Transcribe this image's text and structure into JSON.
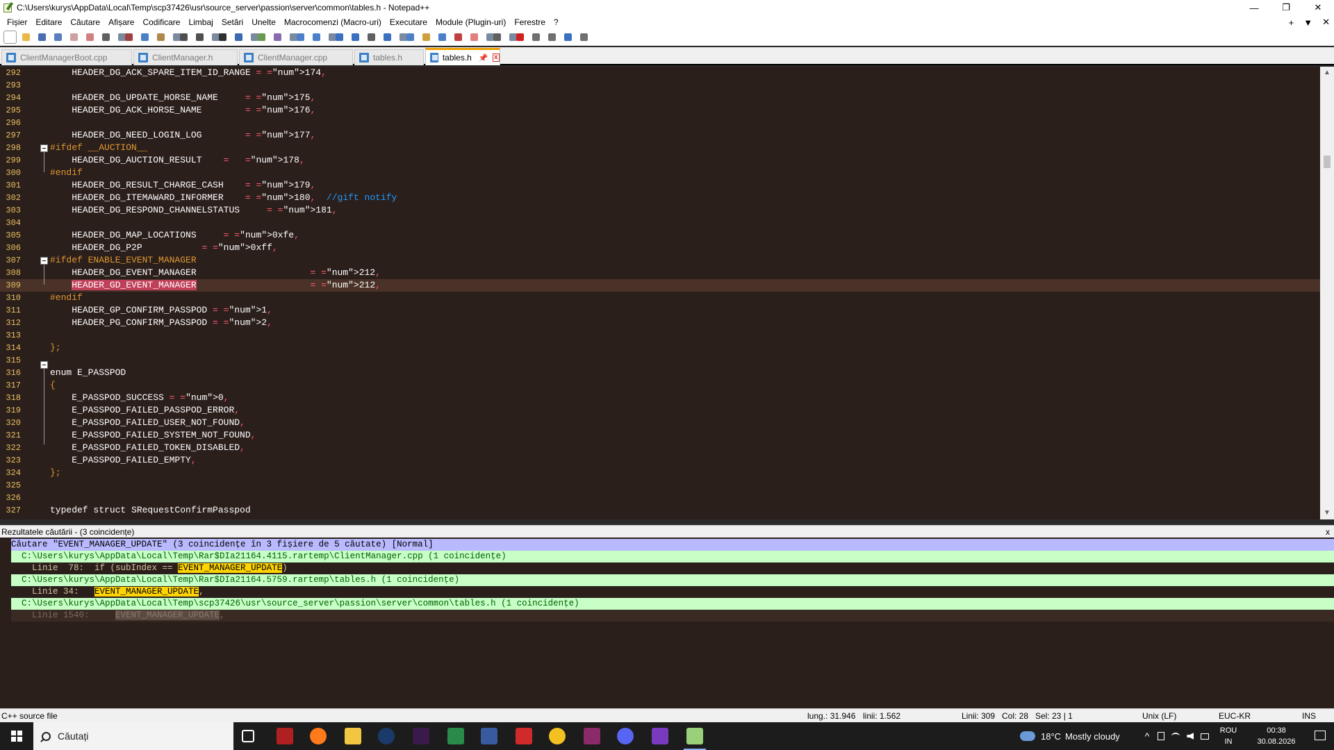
{
  "window": {
    "title": "C:\\Users\\kurys\\AppData\\Local\\Temp\\scp37426\\usr\\source_server\\passion\\server\\common\\tables.h - Notepad++",
    "minimize": "—",
    "maximize": "❐",
    "close": "✕"
  },
  "menu": {
    "items": [
      "Fișier",
      "Editare",
      "Căutare",
      "Afișare",
      "Codificare",
      "Limbaj",
      "Setări",
      "Unelte",
      "Macrocomenzi (Macro-uri)",
      "Executare",
      "Module (Plugin-uri)",
      "Ferestre",
      "?"
    ],
    "right_plus": "+",
    "right_down": "▼",
    "right_close": "✕"
  },
  "tabs": [
    {
      "label": "ClientManagerBoot.cpp",
      "active": false
    },
    {
      "label": "ClientManager.h",
      "active": false
    },
    {
      "label": "ClientManager.cpp",
      "active": false
    },
    {
      "label": "tables.h",
      "active": false
    },
    {
      "label": "tables.h",
      "active": true
    }
  ],
  "tab_pin": "📌",
  "tab_close": "x",
  "editor": {
    "current_line": 309,
    "lines": [
      {
        "n": "292",
        "t": "    HEADER_DG_ACK_SPARE_ITEM_ID_RANGE = 174,"
      },
      {
        "n": "293",
        "t": ""
      },
      {
        "n": "294",
        "t": "    HEADER_DG_UPDATE_HORSE_NAME     = 175,"
      },
      {
        "n": "295",
        "t": "    HEADER_DG_ACK_HORSE_NAME        = 176,"
      },
      {
        "n": "296",
        "t": ""
      },
      {
        "n": "297",
        "t": "    HEADER_DG_NEED_LOGIN_LOG        = 177,"
      },
      {
        "n": "298",
        "t": "#ifdef __AUCTION__"
      },
      {
        "n": "299",
        "t": "    HEADER_DG_AUCTION_RESULT    =   178,"
      },
      {
        "n": "300",
        "t": "#endif"
      },
      {
        "n": "301",
        "t": "    HEADER_DG_RESULT_CHARGE_CASH    = 179,"
      },
      {
        "n": "302",
        "t": "    HEADER_DG_ITEMAWARD_INFORMER    = 180,  //gift notify"
      },
      {
        "n": "303",
        "t": "    HEADER_DG_RESPOND_CHANNELSTATUS     = 181,"
      },
      {
        "n": "304",
        "t": ""
      },
      {
        "n": "305",
        "t": "    HEADER_DG_MAP_LOCATIONS     = 0xfe,"
      },
      {
        "n": "306",
        "t": "    HEADER_DG_P2P           = 0xff,"
      },
      {
        "n": "307",
        "t": "#ifdef ENABLE_EVENT_MANAGER"
      },
      {
        "n": "308",
        "t": "    HEADER_DG_EVENT_MANAGER                     = 212,"
      },
      {
        "n": "309",
        "t": "    HEADER_GD_EVENT_MANAGER                     = 212,"
      },
      {
        "n": "310",
        "t": "#endif"
      },
      {
        "n": "311",
        "t": "    HEADER_GP_CONFIRM_PASSPOD = 1,"
      },
      {
        "n": "312",
        "t": "    HEADER_PG_CONFIRM_PASSPOD = 2,"
      },
      {
        "n": "313",
        "t": ""
      },
      {
        "n": "314",
        "t": "};"
      },
      {
        "n": "315",
        "t": ""
      },
      {
        "n": "316",
        "t": "enum E_PASSPOD"
      },
      {
        "n": "317",
        "t": "{"
      },
      {
        "n": "318",
        "t": "    E_PASSPOD_SUCCESS = 0,"
      },
      {
        "n": "319",
        "t": "    E_PASSPOD_FAILED_PASSPOD_ERROR,"
      },
      {
        "n": "320",
        "t": "    E_PASSPOD_FAILED_USER_NOT_FOUND,"
      },
      {
        "n": "321",
        "t": "    E_PASSPOD_FAILED_SYSTEM_NOT_FOUND,"
      },
      {
        "n": "322",
        "t": "    E_PASSPOD_FAILED_TOKEN_DISABLED,"
      },
      {
        "n": "323",
        "t": "    E_PASSPOD_FAILED_EMPTY,"
      },
      {
        "n": "324",
        "t": "};"
      },
      {
        "n": "325",
        "t": ""
      },
      {
        "n": "326",
        "t": ""
      },
      {
        "n": "327",
        "t": "typedef struct SRequestConfirmPasspod"
      }
    ]
  },
  "results": {
    "title": "Rezultatele căutării - (3 coincidențe)",
    "close": "x",
    "search_line": "Căutare \"EVENT_MANAGER_UPDATE\" (3 coincidențe în 3 fișiere de 5 căutate) [Normal]",
    "groups": [
      {
        "file": "  C:\\Users\\kurys\\AppData\\Local\\Temp\\Rar$DIa21164.4115.rartemp\\ClientManager.cpp (1 coincidențe)",
        "hit_prefix": "    Linie  78:  if (subIndex == ",
        "hit_match": "EVENT_MANAGER_UPDATE",
        "hit_suffix": ")"
      },
      {
        "file": "  C:\\Users\\kurys\\AppData\\Local\\Temp\\Rar$DIa21164.5759.rartemp\\tables.h (1 coincidențe)",
        "hit_prefix": "    Linie 34:   ",
        "hit_match": "EVENT_MANAGER_UPDATE",
        "hit_suffix": ","
      },
      {
        "file": "  C:\\Users\\kurys\\AppData\\Local\\Temp\\scp37426\\usr\\source_server\\passion\\server\\common\\tables.h (1 coincidențe)",
        "hit_prefix": "    Linie 1540:     ",
        "hit_match": "EVENT_MANAGER_UPDATE",
        "hit_suffix": ","
      }
    ]
  },
  "status": {
    "file_type": "C++ source file",
    "length": "lung.: 31.946",
    "lines": "linii: 1.562",
    "position": "Linii: 309",
    "column": "Col: 28",
    "selection": "Sel: 23 | 1",
    "eol": "Unix (LF)",
    "encoding": "EUC-KR",
    "mode": "INS"
  },
  "taskbar": {
    "search_label": "Căutați",
    "weather_temp": "18°C",
    "weather_text": "Mostly cloudy",
    "lang_top": "ROU",
    "lang_bottom": "IN",
    "time": "00:38",
    "date": "30.08.2026",
    "tray_arrow": "^"
  },
  "colors": {
    "editor_bg": "#2b1f1c",
    "current_line": "#4a3228",
    "preprocessor": "#e09830",
    "number": "#ff5a6e",
    "comment": "#1f9bff",
    "selection": "#c0405a",
    "search_header": "#b9b9ff",
    "file_header": "#c7ffc7",
    "match_highlight": "#ffd400",
    "taskbar_bg": "#1c1c1c"
  },
  "icons": {
    "app": "notepadpp-icon",
    "search": "search-icon",
    "start": "windows-start-icon",
    "weather": "cloud-icon",
    "notifications": "notification-icon"
  }
}
